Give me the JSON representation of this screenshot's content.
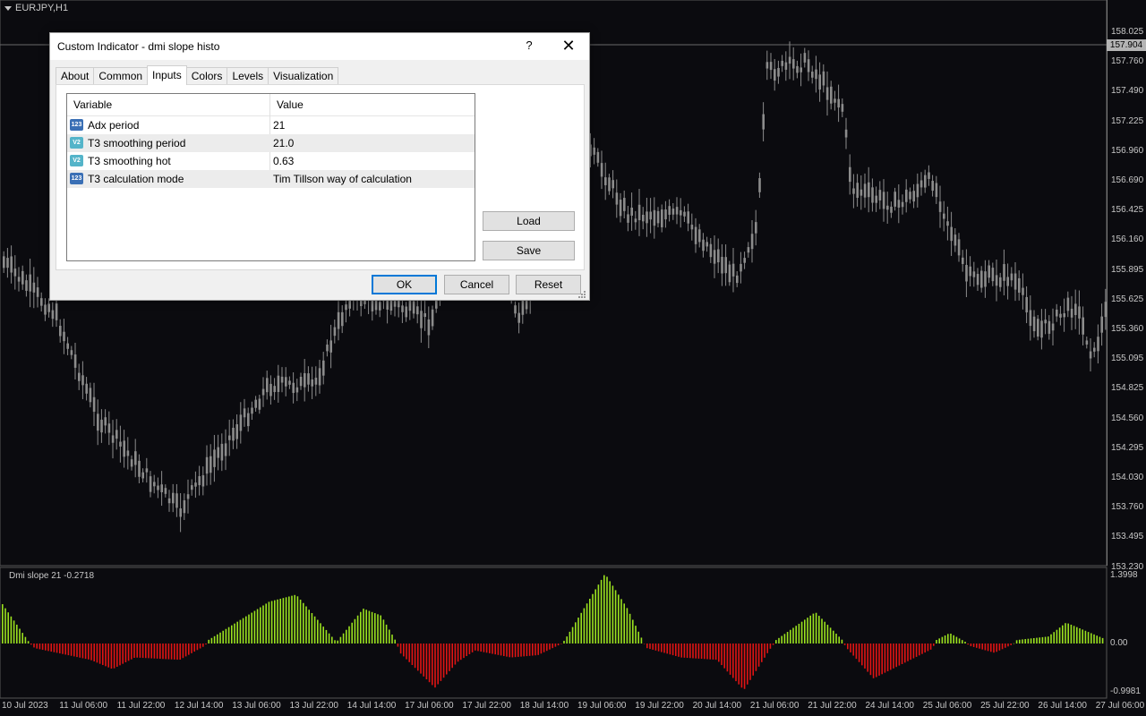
{
  "window": {
    "symbol_label": "EURJPY,H1"
  },
  "price_axis": {
    "ticks": [
      "158.025",
      "157.760",
      "157.490",
      "157.225",
      "156.960",
      "156.690",
      "156.425",
      "156.160",
      "155.895",
      "155.625",
      "155.360",
      "155.095",
      "154.825",
      "154.560",
      "154.295",
      "154.030",
      "153.760",
      "153.495",
      "153.230"
    ],
    "current_price": "157.904"
  },
  "subwindow": {
    "label": "Dmi slope 21 -0.2718",
    "ticks": [
      "1.3998",
      "0.00",
      "-0.9981"
    ]
  },
  "time_axis": {
    "labels": [
      "10 Jul 2023",
      "11 Jul 06:00",
      "11 Jul 22:00",
      "12 Jul 14:00",
      "13 Jul 06:00",
      "13 Jul 22:00",
      "14 Jul 14:00",
      "17 Jul 06:00",
      "17 Jul 22:00",
      "18 Jul 14:00",
      "19 Jul 06:00",
      "19 Jul 22:00",
      "20 Jul 14:00",
      "21 Jul 06:00",
      "21 Jul 22:00",
      "24 Jul 14:00",
      "25 Jul 06:00",
      "25 Jul 22:00",
      "26 Jul 14:00",
      "27 Jul 06:00"
    ]
  },
  "colors": {
    "positive": "#9be21f",
    "negative": "#e01414",
    "candle": "#8c8c8c",
    "background": "#0b0b0f"
  },
  "dialog": {
    "title": "Custom Indicator - dmi slope histo",
    "help": "?",
    "close": "✕",
    "tabs": [
      "About",
      "Common",
      "Inputs",
      "Colors",
      "Levels",
      "Visualization"
    ],
    "active_tab": "Inputs",
    "columns": {
      "variable": "Variable",
      "value": "Value"
    },
    "rows": [
      {
        "icon": "123",
        "variable": "Adx period",
        "value": "21"
      },
      {
        "icon": "V2",
        "variable": "T3 smoothing period",
        "value": "21.0"
      },
      {
        "icon": "V2",
        "variable": "T3 smoothing hot",
        "value": "0.63"
      },
      {
        "icon": "123",
        "variable": "T3 calculation mode",
        "value": "Tim Tillson way of calculation"
      }
    ],
    "buttons": {
      "load": "Load",
      "save": "Save",
      "ok": "OK",
      "cancel": "Cancel",
      "reset": "Reset"
    }
  }
}
